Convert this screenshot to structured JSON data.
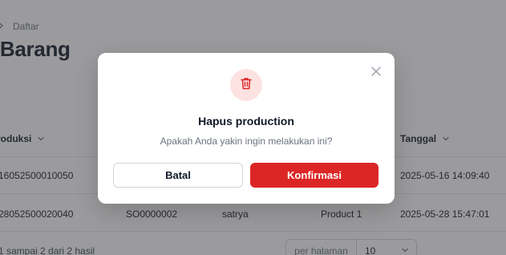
{
  "breadcrumb": {
    "current": "Daftar"
  },
  "page": {
    "title": "i Barang"
  },
  "table": {
    "headers": {
      "produksi": "roduksi",
      "tanggal": "Tanggal"
    },
    "rows": [
      {
        "no": "16052500010050",
        "so": "",
        "user": "",
        "product": "",
        "date": "2025-05-16 14:09:40"
      },
      {
        "no": "28052500020040",
        "so": "SO0000002",
        "user": "satrya",
        "product": "Product 1",
        "date": "2025-05-28 15:47:01"
      }
    ]
  },
  "pagination": {
    "info": "1 sampai 2 dari 2 hasil",
    "per_page_label": "per halaman",
    "per_page_value": "10"
  },
  "modal": {
    "title": "Hapus production",
    "message": "Apakah Anda yakin ingin melakukan ini?",
    "cancel_label": "Batal",
    "confirm_label": "Konfirmasi",
    "icon": "trash-icon",
    "accent_color": "#dc2626",
    "icon_bg_color": "#fde2e2"
  }
}
